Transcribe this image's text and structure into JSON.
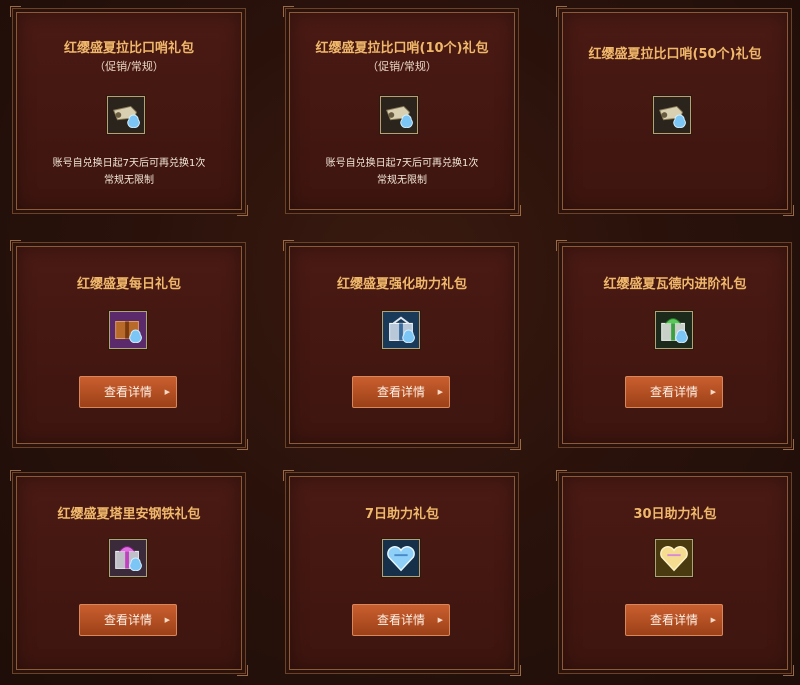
{
  "packs": [
    {
      "title": "红缨盛夏拉比口哨礼包",
      "subtitle": "（促销/常规）",
      "icon": "whistle-icon",
      "notes": [
        "账号自兑换日起7天后可再兑换1次",
        "常规无限制"
      ]
    },
    {
      "title": "红缨盛夏拉比口哨(10个)礼包",
      "subtitle": "（促销/常规）",
      "icon": "whistle-icon",
      "notes": [
        "账号自兑换日起7天后可再兑换1次",
        "常规无限制"
      ]
    },
    {
      "title": "红缨盛夏拉比口哨(50个)礼包",
      "icon": "whistle-icon"
    },
    {
      "title": "红缨盛夏每日礼包",
      "icon": "brown-gift-box-icon",
      "button": "查看详情"
    },
    {
      "title": "红缨盛夏强化助力礼包",
      "icon": "blue-gift-box-icon",
      "button": "查看详情"
    },
    {
      "title": "红缨盛夏瓦德内进阶礼包",
      "icon": "green-gift-box-icon",
      "button": "查看详情"
    },
    {
      "title": "红缨盛夏塔里安钢铁礼包",
      "icon": "silver-gift-box-icon",
      "button": "查看详情"
    },
    {
      "title": "7日助力礼包",
      "icon": "blue-heart-box-icon",
      "button": "查看详情"
    },
    {
      "title": "30日助力礼包",
      "icon": "gold-heart-box-icon",
      "button": "查看详情"
    }
  ],
  "colors": {
    "title": "#f0b86a",
    "button": "#b9522a",
    "card": "#441711"
  }
}
